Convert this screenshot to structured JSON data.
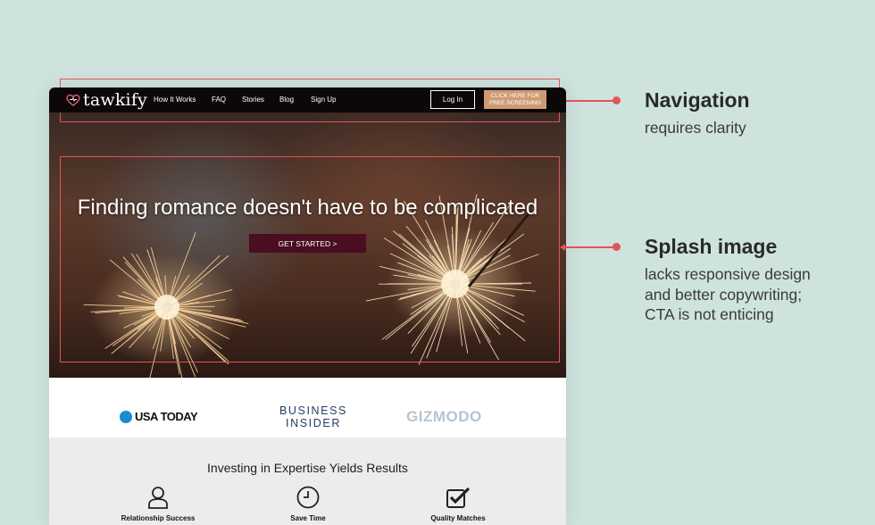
{
  "site": {
    "logo_text": "tawkify",
    "nav": [
      "How It Works",
      "FAQ",
      "Stories",
      "Blog",
      "Sign Up"
    ],
    "login_label": "Log In",
    "screening_line1": "CLICK HERE FOR",
    "screening_line2": "FREE SCREENING",
    "headline": "Finding romance doesn't have to be complicated",
    "cta_label": "GET STARTED >",
    "press": {
      "usa_today": "USA TODAY",
      "business_line1": "BUSINESS",
      "business_line2": "INSIDER",
      "gizmodo": "GIZMODO"
    },
    "results_title": "Investing in Expertise Yields Results",
    "features": [
      {
        "label": "Relationship Success",
        "icon": "person-icon"
      },
      {
        "label": "Save Time",
        "icon": "clock-icon"
      },
      {
        "label": "Quality Matches",
        "icon": "checkbox-icon"
      }
    ]
  },
  "annotations": [
    {
      "title": "Navigation",
      "body": "requires clarity"
    },
    {
      "title": "Splash image",
      "body": "lacks responsive design and better copywriting; CTA is not enticing"
    }
  ],
  "colors": {
    "background": "#cfe3de",
    "annotation_red": "#e2545a",
    "nav_black": "#0c0809",
    "cta_maroon": "#4a0d22",
    "screening_tan": "#cf9a73"
  }
}
